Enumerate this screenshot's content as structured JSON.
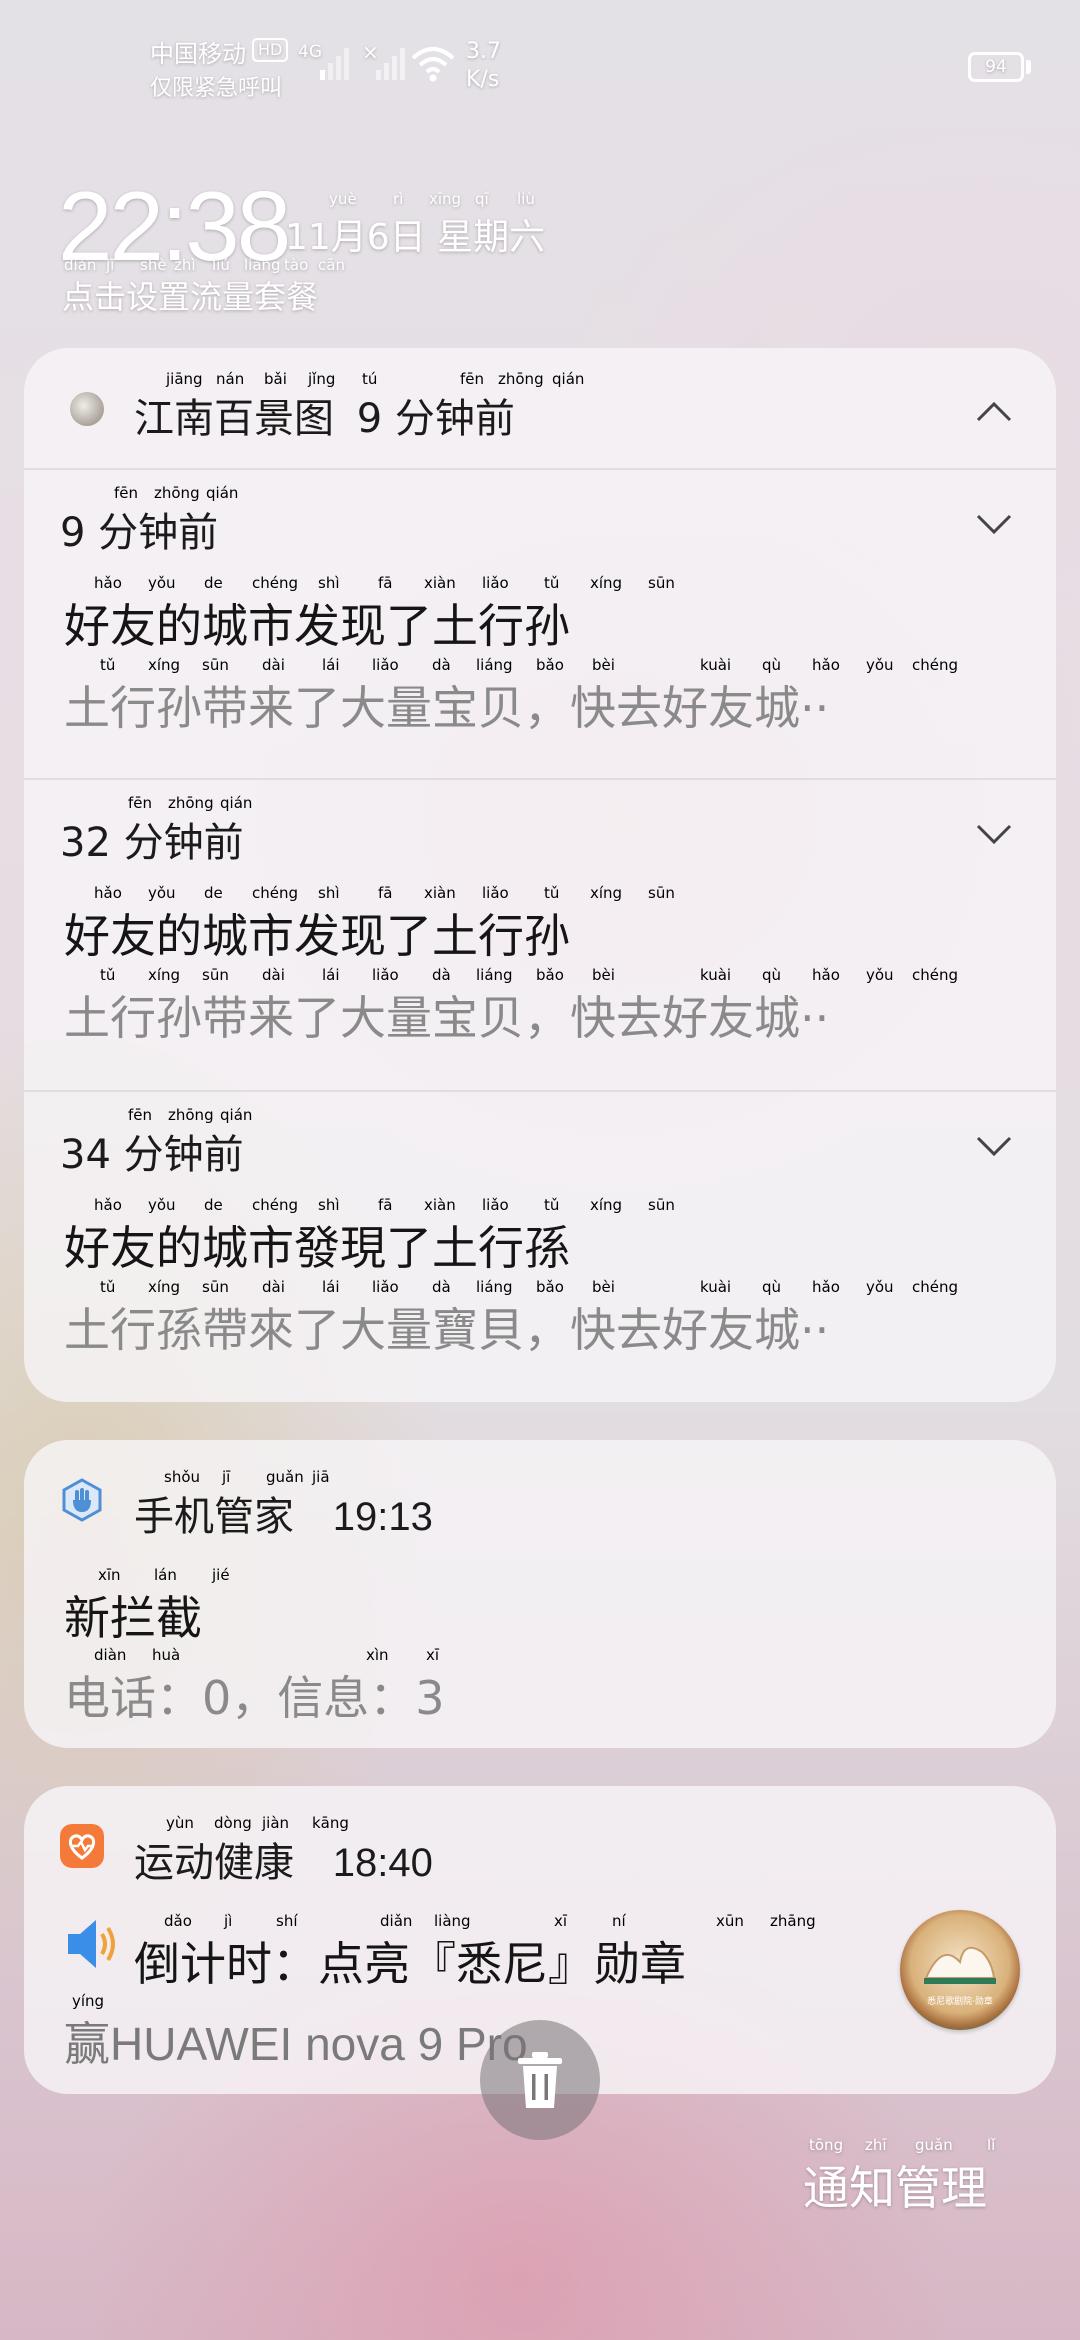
{
  "status_bar": {
    "carrier_line1": "中国移动",
    "hd": "HD",
    "carrier_line2": "仅限紧急呼叫",
    "network": "4G",
    "no_sim": "×",
    "speed_value": "3.7",
    "speed_unit": "K/s",
    "battery": "94"
  },
  "lockscreen": {
    "time": "22:38",
    "date": "11月6日 星期六",
    "date_pinyin": [
      "yuè",
      "rì",
      "xīng",
      "qī",
      "liù"
    ],
    "data_plan": "点击设置流量套餐",
    "data_plan_pinyin": [
      "diǎn",
      "jī",
      "shè",
      "zhì",
      "liú",
      "liàng",
      "tào",
      "cān"
    ]
  },
  "group_notification": {
    "app_name": "江南百景图",
    "app_time": "9 分钟前",
    "header_pinyin": [
      "jiāng",
      "nán",
      "bǎi",
      "jǐng",
      "tú",
      "fēn",
      "zhōng",
      "qián"
    ],
    "items": [
      {
        "time": "9 分钟前",
        "time_pinyin": [
          "fēn",
          "zhōng",
          "qián"
        ],
        "title": "好友的城市发现了土行孙",
        "title_pinyin": [
          "hǎo",
          "yǒu",
          "de",
          "chéng",
          "shì",
          "fā",
          "xiàn",
          "liǎo",
          "tǔ",
          "xíng",
          "sūn"
        ],
        "body": "土行孙带来了大量宝贝，快去好友城··",
        "body_pinyin": [
          "tǔ",
          "xíng",
          "sūn",
          "dài",
          "lái",
          "liǎo",
          "dà",
          "liáng",
          "bǎo",
          "bèi",
          "",
          "kuài",
          "qù",
          "hǎo",
          "yǒu",
          "chéng"
        ]
      },
      {
        "time": "32 分钟前",
        "time_pinyin": [
          "fēn",
          "zhōng",
          "qián"
        ],
        "title": "好友的城市发现了土行孙",
        "title_pinyin": [
          "hǎo",
          "yǒu",
          "de",
          "chéng",
          "shì",
          "fā",
          "xiàn",
          "liǎo",
          "tǔ",
          "xíng",
          "sūn"
        ],
        "body": "土行孙带来了大量宝贝，快去好友城··",
        "body_pinyin": [
          "tǔ",
          "xíng",
          "sūn",
          "dài",
          "lái",
          "liǎo",
          "dà",
          "liáng",
          "bǎo",
          "bèi",
          "",
          "kuài",
          "qù",
          "hǎo",
          "yǒu",
          "chéng"
        ]
      },
      {
        "time": "34 分钟前",
        "time_pinyin": [
          "fēn",
          "zhōng",
          "qián"
        ],
        "title": "好友的城市發現了土行孫",
        "title_pinyin": [
          "hǎo",
          "yǒu",
          "de",
          "chéng",
          "shì",
          "fā",
          "xiàn",
          "liǎo",
          "tǔ",
          "xíng",
          "sūn"
        ],
        "body": "土行孫帶來了大量寶貝，快去好友城··",
        "body_pinyin": [
          "tǔ",
          "xíng",
          "sūn",
          "dài",
          "lái",
          "liǎo",
          "dà",
          "liáng",
          "bǎo",
          "bèi",
          "",
          "kuài",
          "qù",
          "hǎo",
          "yǒu",
          "chéng"
        ]
      }
    ]
  },
  "phone_manager": {
    "app_name": "手机管家",
    "app_name_pinyin": [
      "shǒu",
      "jī",
      "guǎn",
      "jiā"
    ],
    "time": "19:13",
    "title": "新拦截",
    "title_pinyin": [
      "xīn",
      "lán",
      "jié"
    ],
    "body": "电话：0，信息：3",
    "body_pinyin": [
      "diàn",
      "huà",
      "",
      "",
      "",
      "xìn",
      "xī"
    ]
  },
  "health": {
    "app_name": "运动健康",
    "app_name_pinyin": [
      "yùn",
      "dòng",
      "jiàn",
      "kāng"
    ],
    "time": "18:40",
    "title": "倒计时：点亮『悉尼』勋章",
    "title_pinyin": [
      "dǎo",
      "jì",
      "shí",
      "",
      "diǎn",
      "liàng",
      "",
      "xī",
      "ní",
      "",
      "xūn",
      "zhāng"
    ],
    "body_prefix": "赢",
    "body_prefix_pinyin": "yíng",
    "body": "HUAWEI nova 9 Pro",
    "badge_caption": "悉尼歌剧院·勋章"
  },
  "footer": {
    "manage": "通知管理",
    "manage_pinyin": [
      "tōng",
      "zhī",
      "guǎn",
      "lǐ"
    ]
  },
  "icons": {
    "group_app": "jiangnan-app-icon",
    "phone_manager": "shield-hand-icon",
    "health": "heart-icon",
    "speaker": "speaker-icon",
    "trash": "trash-icon"
  },
  "colors": {
    "health_orange": "#f57a3a",
    "shield_blue": "#4e8fd6",
    "speaker_blue": "#3a8ee8"
  }
}
